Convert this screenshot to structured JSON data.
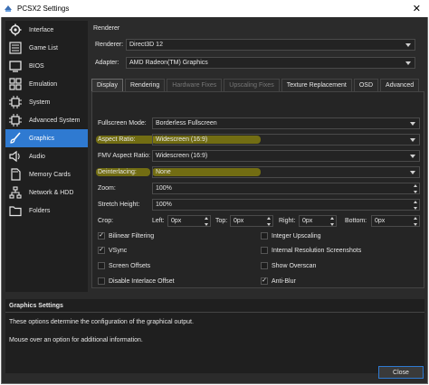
{
  "window": {
    "title": "PCSX2 Settings",
    "close_glyph": "✕"
  },
  "sidebar": {
    "items": [
      {
        "label": "Interface",
        "icon": "interface-icon"
      },
      {
        "label": "Game List",
        "icon": "game-list-icon"
      },
      {
        "label": "BIOS",
        "icon": "bios-icon"
      },
      {
        "label": "Emulation",
        "icon": "emulation-icon"
      },
      {
        "label": "System",
        "icon": "chip-icon"
      },
      {
        "label": "Advanced System",
        "icon": "chip-icon"
      },
      {
        "label": "Graphics",
        "icon": "brush-icon"
      },
      {
        "label": "Audio",
        "icon": "speaker-icon"
      },
      {
        "label": "Memory Cards",
        "icon": "memory-card-icon"
      },
      {
        "label": "Network & HDD",
        "icon": "network-icon"
      },
      {
        "label": "Folders",
        "icon": "folder-icon"
      }
    ],
    "active_index": 6
  },
  "renderer": {
    "section": "Renderer",
    "renderer_label": "Renderer:",
    "renderer_value": "Direct3D 12",
    "adapter_label": "Adapter:",
    "adapter_value": "AMD Radeon(TM) Graphics"
  },
  "tabs": [
    {
      "label": "Display",
      "state": "active"
    },
    {
      "label": "Rendering",
      "state": "normal"
    },
    {
      "label": "Hardware Fixes",
      "state": "disabled"
    },
    {
      "label": "Upscaling Fixes",
      "state": "disabled"
    },
    {
      "label": "Texture Replacement",
      "state": "normal"
    },
    {
      "label": "OSD",
      "state": "normal"
    },
    {
      "label": "Advanced",
      "state": "normal"
    }
  ],
  "display": {
    "fullscreen_label": "Fullscreen Mode:",
    "fullscreen_value": "Borderless Fullscreen",
    "aspect_label": "Aspect Ratio:",
    "aspect_value": "Widescreen (16:9)",
    "fmv_label": "FMV Aspect Ratio:",
    "fmv_value": "Widescreen (16:9)",
    "deinterlace_label": "Deinterlacing:",
    "deinterlace_value": "None",
    "zoom_label": "Zoom:",
    "zoom_value": "100%",
    "stretch_label": "Stretch Height:",
    "stretch_value": "100%",
    "crop_label": "Crop:",
    "crop_left_label": "Left:",
    "crop_left_value": "0px",
    "crop_top_label": "Top:",
    "crop_top_value": "0px",
    "crop_right_label": "Right:",
    "crop_right_value": "0px",
    "crop_bottom_label": "Bottom:",
    "crop_bottom_value": "0px",
    "highlight_color": "#807a10"
  },
  "checkboxes": {
    "bilinear": {
      "label": "Bilinear Filtering",
      "checked": "✓"
    },
    "integer": {
      "label": "Integer Upscaling",
      "checked": ""
    },
    "vsync": {
      "label": "VSync",
      "checked": "✓"
    },
    "internal_res": {
      "label": "Internal Resolution Screenshots",
      "checked": ""
    },
    "offsets": {
      "label": "Screen Offsets",
      "checked": ""
    },
    "overscan": {
      "label": "Show Overscan",
      "checked": ""
    },
    "interlace_offset": {
      "label": "Disable Interlace Offset",
      "checked": ""
    },
    "antiblur": {
      "label": "Anti-Blur",
      "checked": "✓"
    }
  },
  "help": {
    "title": "Graphics Settings",
    "line1": "These options determine the configuration of the graphical output.",
    "line2": "Mouse over an option for additional information."
  },
  "footer": {
    "close_label": "Close"
  },
  "colors": {
    "accent": "#2f7ad1",
    "background": "#2b2b2b",
    "sidebar": "#1f1f1f"
  }
}
